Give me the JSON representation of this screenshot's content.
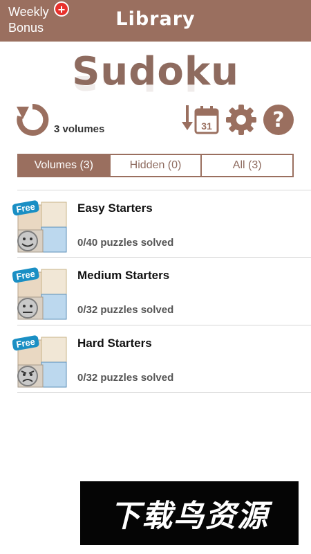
{
  "header": {
    "weekly_bonus_line1": "Weekly",
    "weekly_bonus_line2": "Bonus",
    "badge_symbol": "+",
    "title": "Library"
  },
  "hero": {
    "title": "Sudoku"
  },
  "toolbar": {
    "volumes_count": "3 volumes",
    "calendar_day": "31",
    "icons": [
      "refresh-icon",
      "sort-by-date-icon",
      "gear-icon",
      "help-icon"
    ]
  },
  "tabs": [
    {
      "label": "Volumes (3)",
      "active": true
    },
    {
      "label": "Hidden (0)",
      "active": false
    },
    {
      "label": "All (3)",
      "active": false
    }
  ],
  "volumes": [
    {
      "title": "Easy Starters",
      "progress": "0/40 puzzles solved",
      "badge": "Free",
      "face": "happy"
    },
    {
      "title": "Medium Starters",
      "progress": "0/32 puzzles solved",
      "badge": "Free",
      "face": "neutral"
    },
    {
      "title": "Hard Starters",
      "progress": "0/32 puzzles solved",
      "badge": "Free",
      "face": "angry"
    }
  ],
  "ad_banner": {
    "text": "下载鸟资源"
  },
  "colors": {
    "brand": "#9a6f5f",
    "badge_red": "#e8312c",
    "free_blue": "#1a8fc4"
  }
}
